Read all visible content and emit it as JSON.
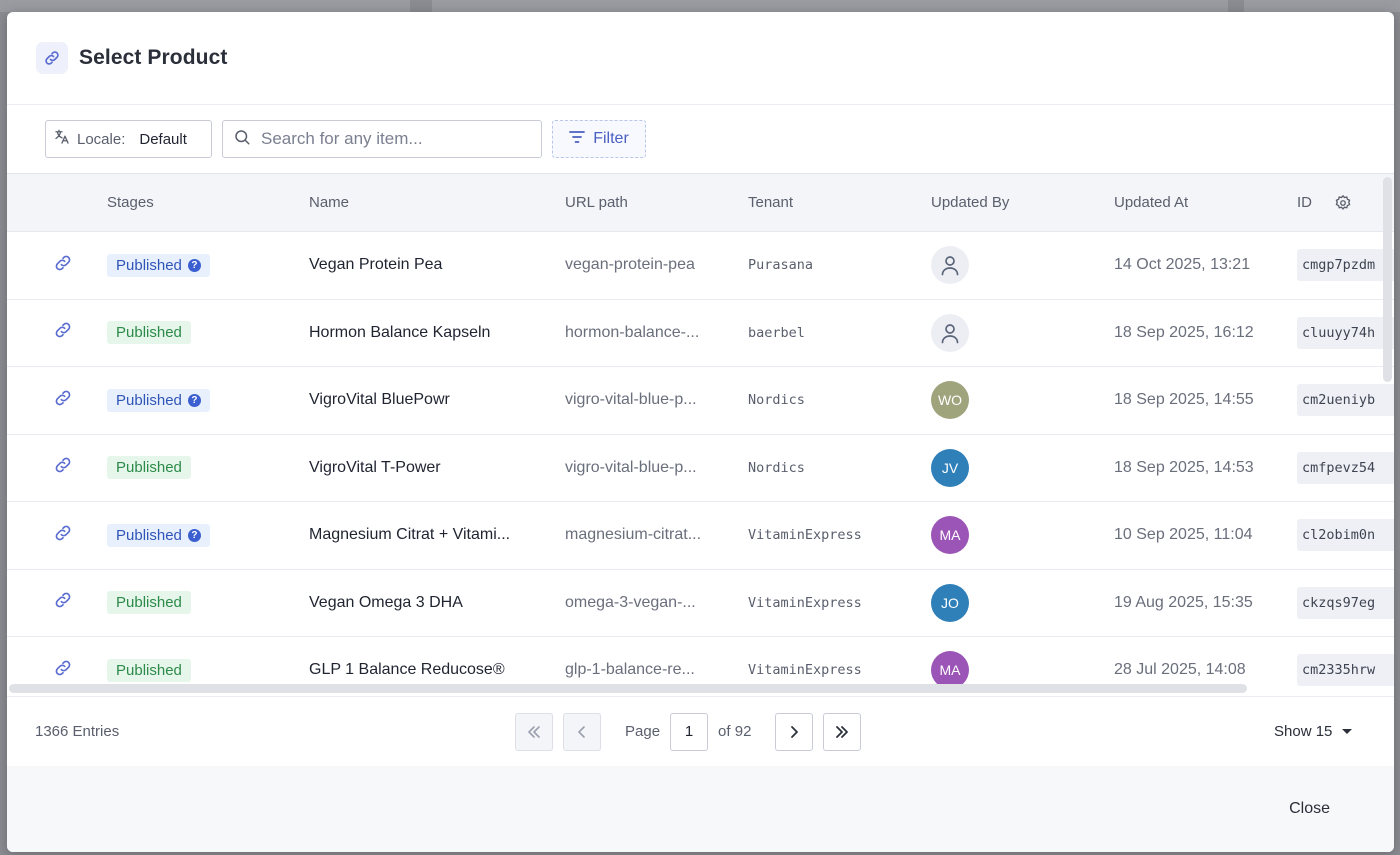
{
  "modal": {
    "title": "Select Product",
    "title_icon": "link-icon"
  },
  "toolbar": {
    "locale_label": "Locale:",
    "locale_value": "Default",
    "search_placeholder": "Search for any item...",
    "search_value": "",
    "filter_label": "Filter"
  },
  "table": {
    "columns": [
      "Stages",
      "Name",
      "URL path",
      "Tenant",
      "Updated By",
      "Updated At",
      "ID"
    ],
    "rows": [
      {
        "stage": "Published",
        "stage_style": "blue",
        "info": true,
        "name": "Vegan Protein Pea",
        "url": "vegan-protein-pea",
        "tenant": "Purasana",
        "avatar": "",
        "avatar_color": "",
        "updated_at": "14 Oct 2025, 13:21",
        "id": "cmgp7pzdm"
      },
      {
        "stage": "Published",
        "stage_style": "green",
        "info": false,
        "name": "Hormon Balance Kapseln",
        "url": "hormon-balance-...",
        "tenant": "baerbel",
        "avatar": "",
        "avatar_color": "",
        "updated_at": "18 Sep 2025, 16:12",
        "id": "cluuyy74h"
      },
      {
        "stage": "Published",
        "stage_style": "blue",
        "info": true,
        "name": "VigroVital BluePowr",
        "url": "vigro-vital-blue-p...",
        "tenant": "Nordics",
        "avatar": "WO",
        "avatar_color": "#a0a47d",
        "updated_at": "18 Sep 2025, 14:55",
        "id": "cm2ueniyb"
      },
      {
        "stage": "Published",
        "stage_style": "green",
        "info": false,
        "name": "VigroVital T-Power",
        "url": "vigro-vital-blue-p...",
        "tenant": "Nordics",
        "avatar": "JV",
        "avatar_color": "#2f7fb8",
        "updated_at": "18 Sep 2025, 14:53",
        "id": "cmfpevz54"
      },
      {
        "stage": "Published",
        "stage_style": "blue",
        "info": true,
        "name": "Magnesium Citrat + Vitami...",
        "url": "magnesium-citrat...",
        "tenant": "VitaminExpress",
        "avatar": "MA",
        "avatar_color": "#9b55b6",
        "updated_at": "10 Sep 2025, 11:04",
        "id": "cl2obim0n"
      },
      {
        "stage": "Published",
        "stage_style": "green",
        "info": false,
        "name": "Vegan Omega 3 DHA",
        "url": "omega-3-vegan-...",
        "tenant": "VitaminExpress",
        "avatar": "JO",
        "avatar_color": "#2f7fb8",
        "updated_at": "19 Aug 2025, 15:35",
        "id": "ckzqs97eg"
      },
      {
        "stage": "Published",
        "stage_style": "green",
        "info": false,
        "name": "GLP 1 Balance Reducose®",
        "url": "glp-1-balance-re...",
        "tenant": "VitaminExpress",
        "avatar": "MA",
        "avatar_color": "#9b55b6",
        "updated_at": "28 Jul 2025, 14:08",
        "id": "cm2335hrw"
      }
    ]
  },
  "footer": {
    "entries": "1366 Entries",
    "page_label": "Page",
    "page_value": "1",
    "of_label": "of 92",
    "show_label": "Show 15",
    "close_label": "Close"
  }
}
